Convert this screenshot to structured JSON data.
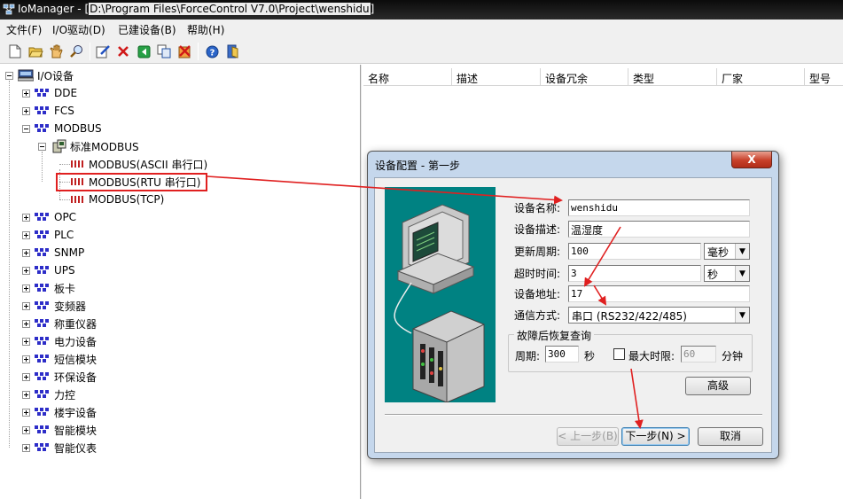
{
  "window": {
    "title_prefix": "IoManager - [",
    "title_path": "D:\\Program Files\\ForceControl V7.0\\Project\\wenshidu",
    "title_suffix": "]"
  },
  "menu": [
    "文件(F)",
    "I/O驱动(D)",
    "已建设备(B)",
    "帮助(H)"
  ],
  "toolbar": {
    "icons": [
      "new-icon",
      "open-icon",
      "hand-icon",
      "find-icon",
      "edit-icon",
      "delete-icon",
      "green-arrow-icon",
      "copy-icon",
      "delete-all-icon",
      "help-icon",
      "exit-icon"
    ]
  },
  "tree": {
    "root": "I/O设备",
    "items": {
      "dde": "DDE",
      "fcs": "FCS",
      "modbus": "MODBUS",
      "std_modbus": "标准MODBUS",
      "ascii": "MODBUS(ASCII 串行口)",
      "rtu": "MODBUS(RTU 串行口)",
      "tcp": "MODBUS(TCP)",
      "opc": "OPC",
      "plc": "PLC",
      "snmp": "SNMP",
      "ups": "UPS",
      "card": "板卡",
      "inverter": "变频器",
      "weigh": "称重仪器",
      "power": "电力设备",
      "sms": "短信模块",
      "env": "环保设备",
      "force": "力控",
      "building": "楼宇设备",
      "smart_module": "智能模块",
      "smart_meter": "智能仪表"
    }
  },
  "list": {
    "columns": [
      "名称",
      "描述",
      "设备冗余",
      "类型",
      "厂家",
      "型号"
    ]
  },
  "dialog": {
    "title": "设备配置 - 第一步",
    "close": "X",
    "labels": {
      "name": "设备名称:",
      "desc": "设备描述:",
      "period": "更新周期:",
      "timeout": "超时时间:",
      "address": "设备地址:",
      "comm": "通信方式:"
    },
    "values": {
      "name": "wenshidu",
      "desc": "温湿度",
      "period": "100",
      "period_unit": "毫秒",
      "timeout": "3",
      "timeout_unit": "秒",
      "address": "17",
      "comm": "串口 (RS232/422/485)"
    },
    "recovery": {
      "title": "故障后恢复查询",
      "period_label": "周期:",
      "period_value": "300",
      "period_unit": "秒",
      "max_label": "最大时限:",
      "max_value": "60",
      "max_unit": "分钟",
      "max_checked": false
    },
    "buttons": {
      "advanced": "高级",
      "prev": "< 上一步(B)",
      "next": "下一步(N) >",
      "cancel": "取消"
    }
  },
  "colors": {
    "annotation_red": "#e02020",
    "illustration_bg": "#008282",
    "dialog_frame": "#c5d7ec"
  }
}
